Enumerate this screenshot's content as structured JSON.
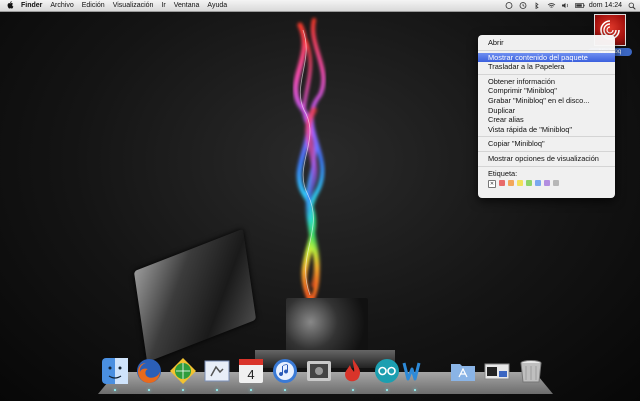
{
  "menubar": {
    "apple": "",
    "items": [
      "Finder",
      "Archivo",
      "Edición",
      "Visualización",
      "Ir",
      "Ventana",
      "Ayuda"
    ],
    "clock": "dom 14:24",
    "tray_icons": [
      "bluetooth-icon",
      "wifi-icon",
      "volume-icon",
      "battery-icon",
      "spotlight-icon"
    ]
  },
  "desktop_icon": {
    "label": "Minibloq"
  },
  "context_menu": {
    "groups": [
      [
        "Abrir"
      ],
      [
        "Mostrar contenido del paquete",
        "Trasladar a la Papelera"
      ],
      [
        "Obtener información",
        "Comprimir \"Minibloq\"",
        "Grabar \"Minibloq\" en el disco...",
        "Duplicar",
        "Crear alias",
        "Vista rápida de \"Minibloq\""
      ],
      [
        "Copiar \"Minibloq\""
      ],
      [
        "Mostrar opciones de visualización"
      ]
    ],
    "highlighted": "Mostrar contenido del paquete",
    "tag_label": "Etiqueta:",
    "tag_colors": [
      "#e86a6a",
      "#f2a65a",
      "#f2e15a",
      "#8fd46b",
      "#7aa8ef",
      "#b28ee0",
      "#b7b7b7"
    ]
  },
  "dock": {
    "calendar_day": "4",
    "apps": [
      {
        "name": "finder-icon",
        "color": "#4a8fe0"
      },
      {
        "name": "firefox-icon",
        "color": "#e86a1c"
      },
      {
        "name": "globe-app-icon",
        "color": "#2f9d3c"
      },
      {
        "name": "mail-icon",
        "color": "#7a8fb6"
      },
      {
        "name": "calendar-icon",
        "color": "#f0f0f0"
      },
      {
        "name": "itunes-icon",
        "color": "#3a7ad6"
      },
      {
        "name": "photo-booth-icon",
        "color": "#c9c9c9"
      },
      {
        "name": "flame-app-icon",
        "color": "#d9342a"
      },
      {
        "name": "arduino-icon",
        "color": "#1c9fb0"
      },
      {
        "name": "w-app-icon",
        "color": "#2d8ad8"
      },
      {
        "name": "applications-folder-icon",
        "color": "#8ab4e6"
      },
      {
        "name": "preview-window-icon",
        "color": "#e8e8e8"
      },
      {
        "name": "trash-icon",
        "color": "#bfbfbf"
      }
    ]
  }
}
